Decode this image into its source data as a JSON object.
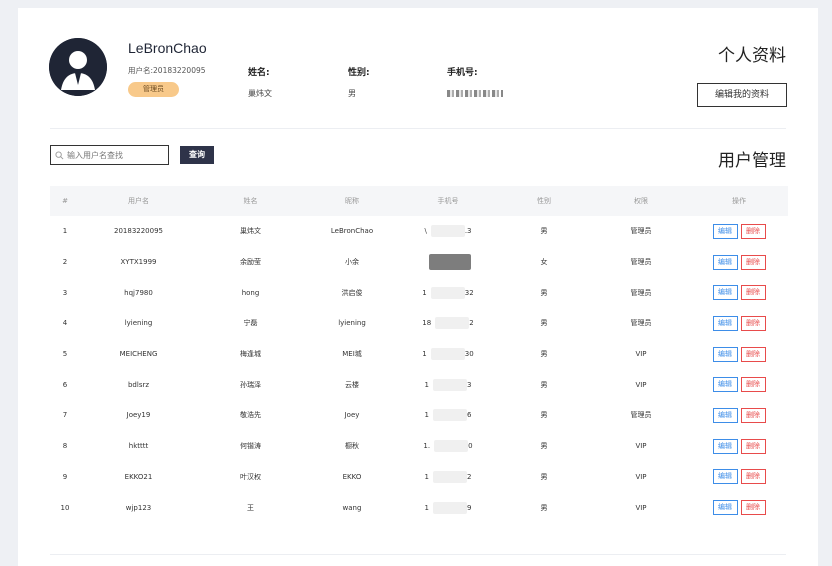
{
  "profile": {
    "username": "LeBronChao",
    "user_id_text": "用户名:20183220095",
    "role_badge": "管理员",
    "name_label": "姓名:",
    "name_value": "巢炜文",
    "gender_label": "性别:",
    "gender_value": "男",
    "phone_label": "手机号:",
    "title": "个人资料",
    "edit_button": "编辑我的资料"
  },
  "search": {
    "placeholder": "输入用户名查找",
    "button_label": "查询",
    "icon": "search-icon"
  },
  "users_title": "用户管理",
  "table": {
    "headers": [
      "#",
      "用户名",
      "姓名",
      "昵称",
      "手机号",
      "性别",
      "权限",
      "操作"
    ],
    "edit_label": "编辑",
    "delete_label": "删除",
    "rows": [
      {
        "index": "1",
        "username": "20183220095",
        "name": "巢炜文",
        "nickname": "LeBronChao",
        "phone_start": "\\",
        "phone_end": ".3",
        "gender": "男",
        "role": "管理员"
      },
      {
        "index": "2",
        "username": "XYTX1999",
        "name": "余励莹",
        "nickname": "小余",
        "phone_start": "",
        "phone_end": "",
        "gender": "女",
        "role": "管理员"
      },
      {
        "index": "3",
        "username": "hqj7980",
        "name": "hong",
        "nickname": "洪启俊",
        "phone_start": "1",
        "phone_end": "32",
        "gender": "男",
        "role": "管理员"
      },
      {
        "index": "4",
        "username": "lyiening",
        "name": "宁磊",
        "nickname": "lyiening",
        "phone_start": "18",
        "phone_end": "2",
        "gender": "男",
        "role": "管理员"
      },
      {
        "index": "5",
        "username": "MEICHENG",
        "name": "梅逢城",
        "nickname": "MEI城",
        "phone_start": "1",
        "phone_end": "30",
        "gender": "男",
        "role": "VIP"
      },
      {
        "index": "6",
        "username": "bdlsrz",
        "name": "孙瑞泽",
        "nickname": "云楼",
        "phone_start": "1",
        "phone_end": "3",
        "gender": "男",
        "role": "VIP"
      },
      {
        "index": "7",
        "username": "Joey19",
        "name": "敬浩先",
        "nickname": "Joey",
        "phone_start": "1",
        "phone_end": "6",
        "gender": "男",
        "role": "管理员"
      },
      {
        "index": "8",
        "username": "hktttt",
        "name": "何锴涛",
        "nickname": "橱秋",
        "phone_start": "1.",
        "phone_end": "0",
        "gender": "男",
        "role": "VIP"
      },
      {
        "index": "9",
        "username": "EKKO21",
        "name": "叶汉权",
        "nickname": "EKKO",
        "phone_start": "1",
        "phone_end": "2",
        "gender": "男",
        "role": "VIP"
      },
      {
        "index": "10",
        "username": "wjp123",
        "name": "王",
        "nickname": "wang",
        "phone_start": "1",
        "phone_end": "9",
        "gender": "男",
        "role": "VIP"
      }
    ]
  },
  "colors": {
    "accent_dark": "#2e3349",
    "badge": "#f8c98a",
    "edit": "#3d8de8",
    "delete": "#e84b4b"
  }
}
